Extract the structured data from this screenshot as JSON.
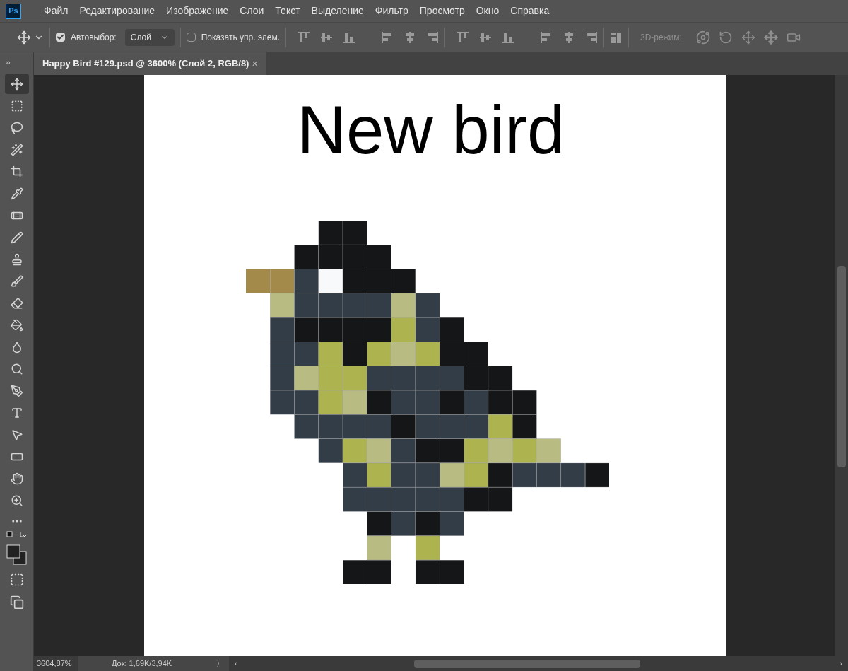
{
  "app_logo": "Ps",
  "menu": [
    "Файл",
    "Редактирование",
    "Изображение",
    "Слои",
    "Текст",
    "Выделение",
    "Фильтр",
    "Просмотр",
    "Окно",
    "Справка"
  ],
  "options_bar": {
    "auto_select": {
      "label": "Автовыбор:",
      "checked": true
    },
    "target": {
      "value": "Слой"
    },
    "show_controls": {
      "label": "Показать упр. элем.",
      "checked": false
    },
    "mode_3d_label": "3D-режим:"
  },
  "panel_toggle": "››",
  "document_tab": {
    "title": "Happy Bird #129.psd @ 3600% (Слой 2, RGB/8)",
    "close": "×",
    "selected": true
  },
  "tools": [
    {
      "selected": true
    },
    {
      "selected": false
    },
    {
      "selected": false
    },
    {
      "selected": false
    },
    {
      "selected": false
    },
    {
      "selected": false
    },
    {
      "selected": false
    },
    {
      "selected": false
    },
    {
      "selected": false
    },
    {
      "selected": false
    },
    {
      "selected": false
    },
    {
      "selected": false
    },
    {
      "selected": false
    },
    {
      "selected": false
    },
    {
      "selected": false
    },
    {
      "selected": false
    },
    {
      "selected": false
    },
    {
      "selected": false
    },
    {
      "selected": false
    },
    {
      "selected": false
    }
  ],
  "canvas": {
    "handwriting": "New bird"
  },
  "status_bar": {
    "zoom": "3604,87%",
    "doc_size": "Док: 1,69K/3,94K",
    "menu_arrow": "〉",
    "scroll_left": "‹",
    "scroll_right": "›"
  }
}
